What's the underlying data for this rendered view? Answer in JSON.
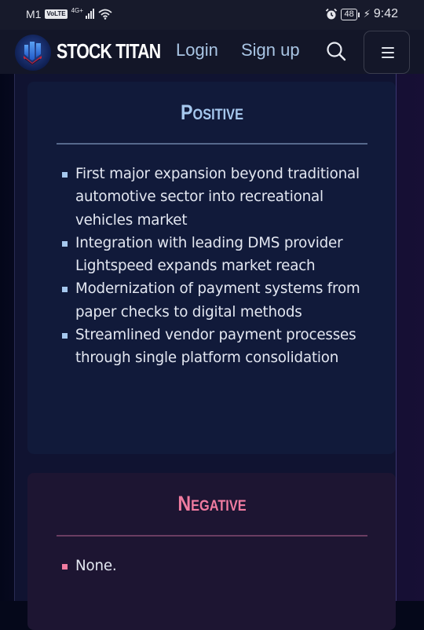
{
  "status_bar": {
    "carrier": "M1",
    "volte": "VoLTE",
    "network": "4G+",
    "battery": "48",
    "time": "9:42"
  },
  "navbar": {
    "brand": "STOCK TITAN",
    "login_label": "Login",
    "signup_label": "Sign up",
    "search_icon": "search-icon",
    "menu_icon": "hamburger-icon"
  },
  "colors": {
    "positive_accent": "#a6c8ee",
    "negative_accent": "#f07ba0",
    "nav_link": "#a9c5e4"
  },
  "positive": {
    "title": "Positive",
    "items": [
      "First major expansion beyond traditional automotive sector into recreational vehicles market",
      "Integration with leading DMS provider Lightspeed expands market reach",
      "Modernization of payment systems from paper checks to digital methods",
      "Streamlined vendor payment processes through single platform consolidation"
    ]
  },
  "negative": {
    "title": "Negative",
    "items": [
      "None."
    ]
  }
}
